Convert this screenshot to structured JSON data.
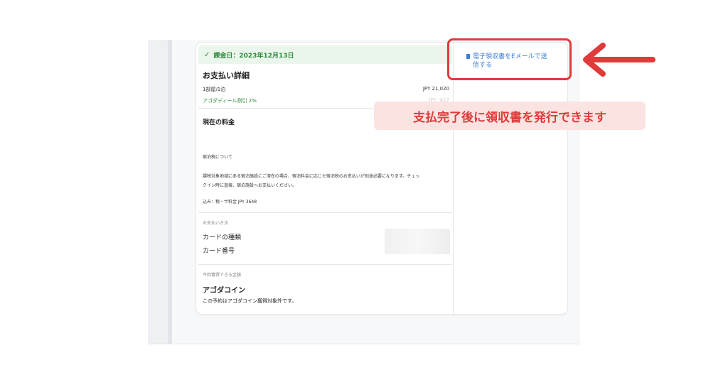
{
  "charge": {
    "check_icon": "check-icon",
    "label": "課金日：2023年12月13日"
  },
  "payment_details": {
    "title": "お支払い詳細",
    "room_label": "1部屋/1泊",
    "room_price": "JPY 21,020",
    "discount_label": "アゴダディール割引 2%",
    "discount_value": "JPY -417"
  },
  "current_price": {
    "title": "現在の料金",
    "tax_heading": "宿泊税について",
    "tax_text_1": "課税対象地域にある宿泊施設にご滞在の場合、宿泊料金に応じた宿泊税のお支払いが別途必要になります。チェッ",
    "tax_text_2": "クイン時に直接、宿泊施設へお支払いください。",
    "included": "込み：税・サ料金 JPY 3648"
  },
  "payment_method": {
    "heading": "お支払い方法",
    "card_type": "カードの種類",
    "card_number": "カード番号"
  },
  "earnable": {
    "heading": "今回獲得できる金額",
    "title": "アゴダコイン",
    "note": "この予約はアゴダコイン獲得対象外です。"
  },
  "receipt": {
    "icon": "document-icon",
    "line1": "電子領収書をEメールで送",
    "line2": "信する"
  },
  "annotation": {
    "callout": "支払完了後に領収書を発行できます",
    "accent": "#e03a3a",
    "arrow_icon": "red-arrow-left-icon"
  }
}
